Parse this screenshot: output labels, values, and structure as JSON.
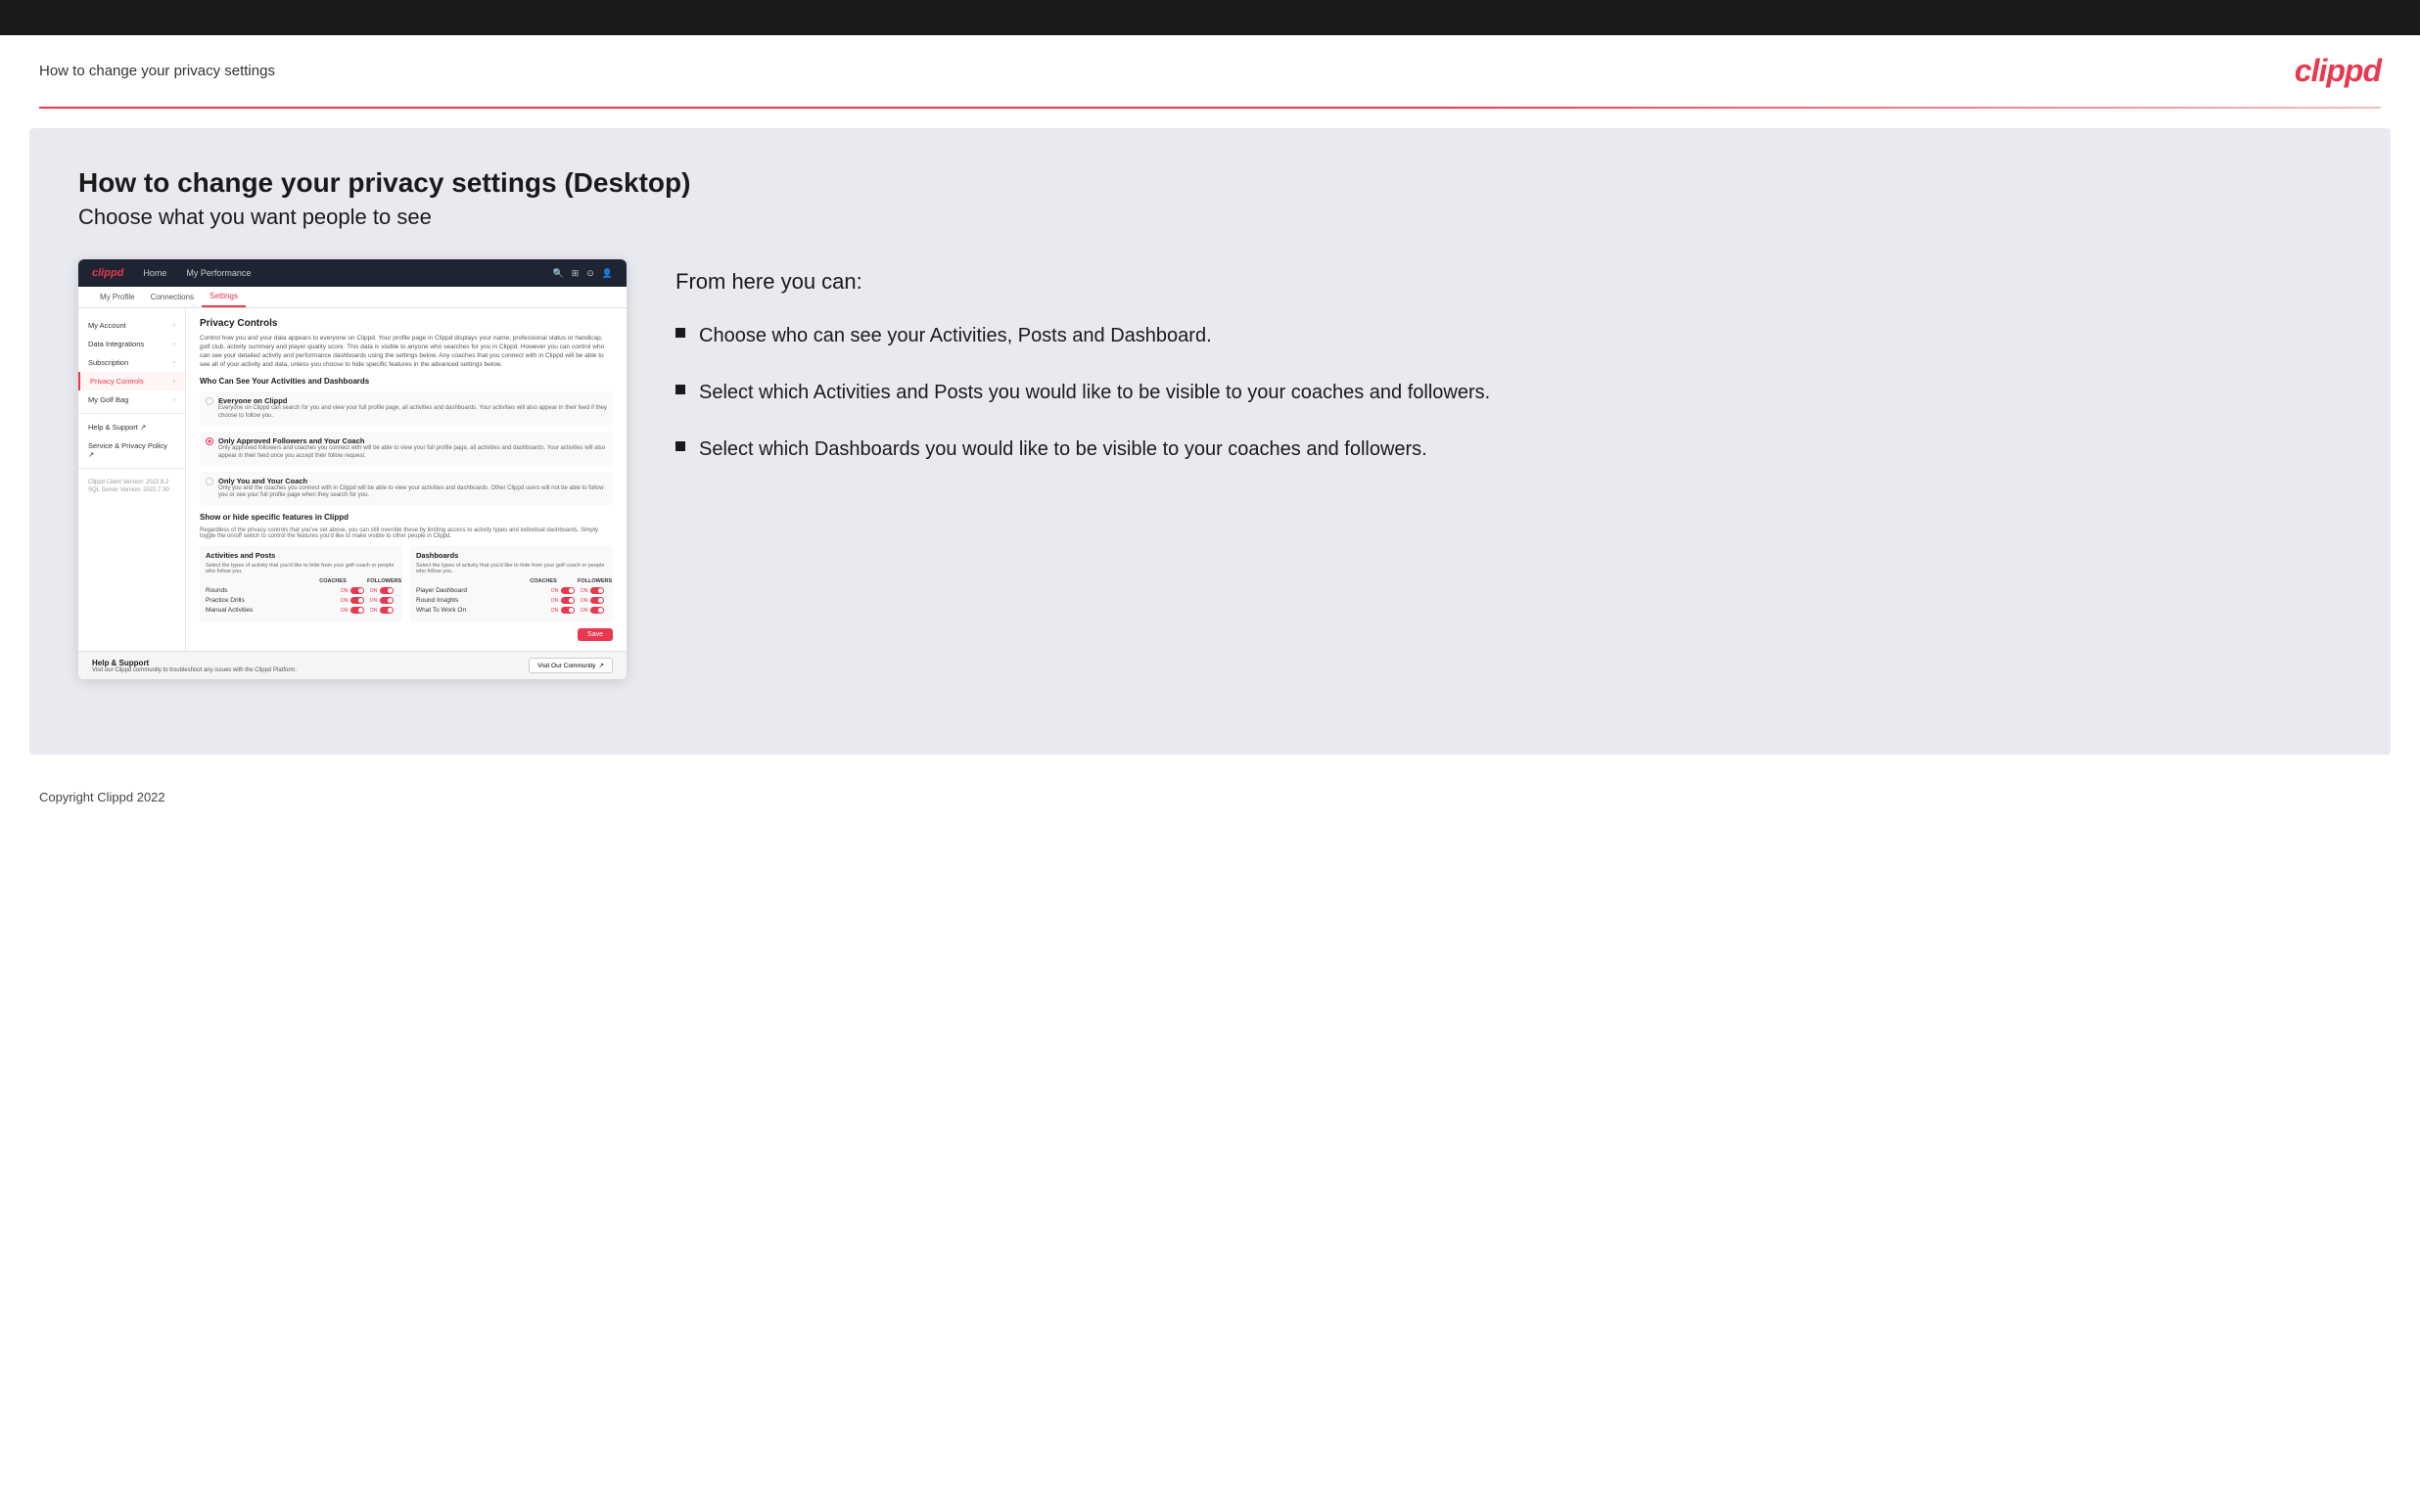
{
  "topBar": {},
  "header": {
    "title": "How to change your privacy settings",
    "logo": "clippd"
  },
  "main": {
    "heading": "How to change your privacy settings (Desktop)",
    "subheading": "Choose what you want people to see",
    "fromHereTitle": "From here you can:",
    "bullets": [
      "Choose who can see your Activities, Posts and Dashboard.",
      "Select which Activities and Posts you would like to be visible to your coaches and followers.",
      "Select which Dashboards you would like to be visible to your coaches and followers."
    ]
  },
  "appMockup": {
    "nav": {
      "logo": "clippd",
      "links": [
        "Home",
        "My Performance"
      ],
      "icons": [
        "🔍",
        "⊞",
        "⊙",
        "👤"
      ]
    },
    "subnav": [
      "My Profile",
      "Connections",
      "Settings"
    ],
    "activeSubnav": "Settings",
    "sidebar": {
      "items": [
        {
          "label": "My Account",
          "chevron": true,
          "active": false
        },
        {
          "label": "Data Integrations",
          "chevron": true,
          "active": false
        },
        {
          "label": "Subscription",
          "chevron": true,
          "active": false
        },
        {
          "label": "Privacy Controls",
          "chevron": true,
          "active": true
        },
        {
          "label": "My Golf Bag",
          "chevron": true,
          "active": false
        },
        {
          "label": "Help & Support ↗",
          "chevron": false,
          "active": false
        },
        {
          "label": "Service & Privacy Policy ↗",
          "chevron": false,
          "active": false
        }
      ],
      "version": "Clippd Client Version: 2022.8.2\nSQL Server Version: 2022.7.30"
    },
    "content": {
      "sectionTitle": "Privacy Controls",
      "sectionDesc": "Control how you and your data appears to everyone on Clippd. Your profile page in Clippd displays your name, professional status or handicap, golf club, activity summary and player quality score. This data is visible to anyone who searches for you in Clippd. However you can control who can see your detailed activity and performance dashboards using the settings below. Any coaches that you connect with in Clippd will be able to see all of your activity and data, unless you choose to hide specific features in the advanced settings below.",
      "whoCanSeeTitle": "Who Can See Your Activities and Dashboards",
      "radioOptions": [
        {
          "id": "everyone",
          "selected": false,
          "title": "Everyone on Clippd",
          "desc": "Everyone on Clippd can search for you and view your full profile page, all activities and dashboards. Your activities will also appear in their feed if they choose to follow you."
        },
        {
          "id": "followers-coach",
          "selected": true,
          "title": "Only Approved Followers and Your Coach",
          "desc": "Only approved followers and coaches you connect with will be able to view your full profile page, all activities and dashboards. Your activities will also appear in their feed once you accept their follow request."
        },
        {
          "id": "only-coach",
          "selected": false,
          "title": "Only You and Your Coach",
          "desc": "Only you and the coaches you connect with in Clippd will be able to view your activities and dashboards. Other Clippd users will not be able to follow you or see your full profile page when they search for you."
        }
      ],
      "showHideTitle": "Show or hide specific features in Clippd",
      "showHideDesc": "Regardless of the privacy controls that you've set above, you can still override these by limiting access to activity types and individual dashboards. Simply toggle the on/off switch to control the features you'd like to make visible to other people in Clippd.",
      "activitiesTable": {
        "title": "Activities and Posts",
        "desc": "Select the types of activity that you'd like to hide from your golf coach or people who follow you.",
        "columns": [
          "COACHES",
          "FOLLOWERS"
        ],
        "rows": [
          {
            "label": "Rounds",
            "coaches": "ON",
            "followers": "ON"
          },
          {
            "label": "Practice Drills",
            "coaches": "ON",
            "followers": "ON"
          },
          {
            "label": "Manual Activities",
            "coaches": "ON",
            "followers": "ON"
          }
        ]
      },
      "dashboardsTable": {
        "title": "Dashboards",
        "desc": "Select the types of activity that you'd like to hide from your golf coach or people who follow you.",
        "columns": [
          "COACHES",
          "FOLLOWERS"
        ],
        "rows": [
          {
            "label": "Player Dashboard",
            "coaches": "ON",
            "followers": "ON"
          },
          {
            "label": "Round Insights",
            "coaches": "ON",
            "followers": "ON"
          },
          {
            "label": "What To Work On",
            "coaches": "ON",
            "followers": "ON"
          }
        ]
      },
      "saveButton": "Save"
    },
    "helpBar": {
      "title": "Help & Support",
      "desc": "Visit our Clippd community to troubleshoot any issues with the Clippd Platform.",
      "button": "Visit Our Community ↗"
    }
  },
  "footer": {
    "text": "Copyright Clippd 2022"
  }
}
